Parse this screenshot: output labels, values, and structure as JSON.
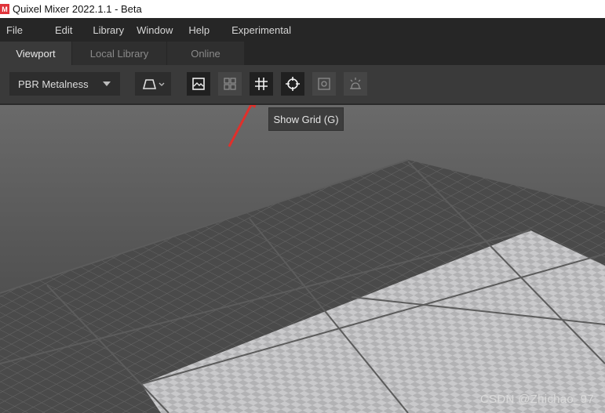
{
  "window": {
    "title": "Quixel Mixer 2022.1.1 - Beta",
    "logo_glyph": "M"
  },
  "menu": [
    "File",
    "Edit",
    "Library",
    "Window",
    "Help",
    "Experimental"
  ],
  "tabs": [
    {
      "label": "Viewport",
      "active": true
    },
    {
      "label": "Local Library",
      "active": false
    },
    {
      "label": "Online",
      "active": false
    }
  ],
  "toolbar": {
    "render_mode": "PBR Metalness",
    "buttons": [
      {
        "icon": "image-icon",
        "state": "on"
      },
      {
        "icon": "grid-layout-icon",
        "state": "off"
      },
      {
        "icon": "grid-icon",
        "state": "on"
      },
      {
        "icon": "crosshair-icon",
        "state": "on"
      },
      {
        "icon": "frame-icon",
        "state": "off"
      },
      {
        "icon": "light-icon",
        "state": "off"
      }
    ]
  },
  "tooltip": {
    "text": "Show Grid (G)"
  },
  "watermark": "CSDN @Zhichao_97",
  "colors": {
    "accent_arrow": "#e0302b",
    "toolbar_bg": "#3a3a3a",
    "menubar_bg": "#262626"
  }
}
